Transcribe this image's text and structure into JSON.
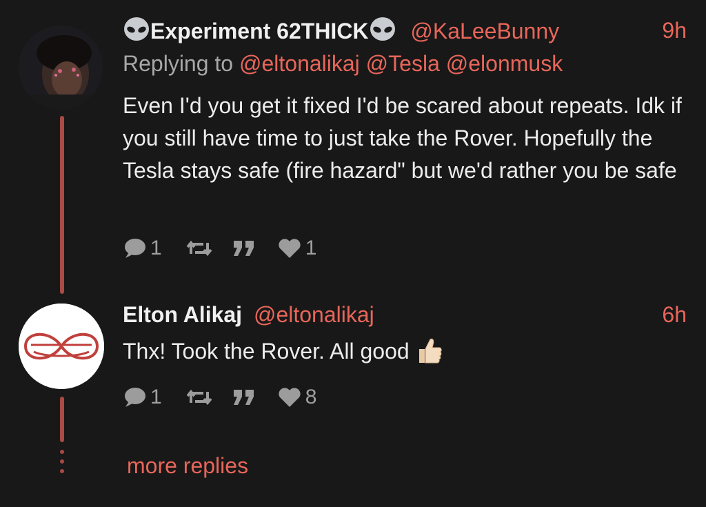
{
  "tweet1": {
    "name": "Experiment 62THICK",
    "name_icons": "alien-emoji",
    "handle": "@KaLeeBunny",
    "time": "9h",
    "replying_prefix": "Replying to",
    "replying_handles": [
      "@eltonalikaj",
      "@Tesla",
      "@elonmusk"
    ],
    "body": "Even I'd you get it fixed I'd be scared about repeats. Idk if you still have time to just take the Rover. Hopefully the Tesla stays safe (fire hazard\" but we'd rather you be safe",
    "replies": "1",
    "likes": "1"
  },
  "tweet2": {
    "name": "Elton Alikaj",
    "handle": "@eltonalikaj",
    "time": "6h",
    "body": "Thx! Took the Rover. All good",
    "body_icon": "thumbs-up-emoji",
    "replies": "1",
    "likes": "8"
  },
  "more_replies": "more replies",
  "colors": {
    "accent": "#e8665a",
    "thread": "#a94a45",
    "background": "#181818",
    "icon": "#9c9c9c"
  }
}
